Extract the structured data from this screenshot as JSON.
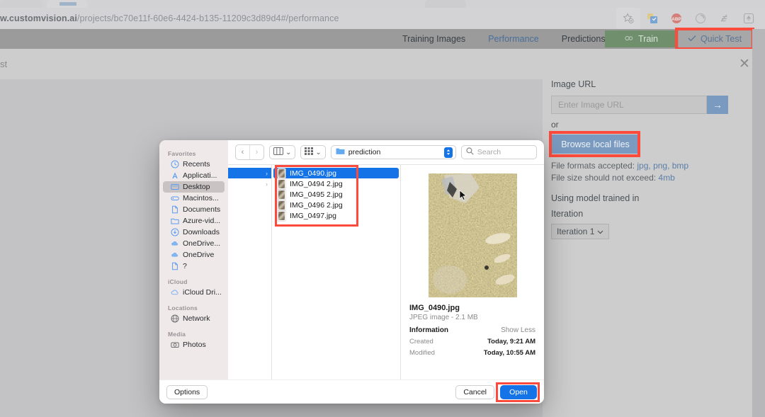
{
  "browser": {
    "url_prefix": "w.customvision.ai",
    "url_path": "/projects/bc70e11f-60e6-4424-b135-11209c3d89d4#/performance",
    "toolbar_icons": [
      "star-add-icon",
      "extension-icon",
      "adblock-plus-icon",
      "circle-icon",
      "reader-icon",
      "sync-icon"
    ]
  },
  "app": {
    "nav_tabs": [
      {
        "label": "Training Images",
        "selected": false
      },
      {
        "label": "Performance",
        "selected": true
      },
      {
        "label": "Predictions",
        "selected": false
      }
    ],
    "train_button": "Train",
    "quick_test_button": "Quick Test"
  },
  "modal": {
    "title": "st",
    "close": "✕",
    "image_url_label": "Image URL",
    "url_placeholder": "Enter Image URL",
    "url_go": "→",
    "or_label": "or",
    "browse_button": "Browse local files",
    "formats_prefix": "File formats accepted: ",
    "formats_value": "jpg, png, bmp",
    "size_prefix": "File size should not exceed: ",
    "size_value": "4mb",
    "using_model_label": "Using model trained in",
    "iteration_label": "Iteration",
    "iteration_value": "Iteration 1",
    "iteration_caret": "⌄"
  },
  "file_dialog": {
    "toolbar": {
      "back": "‹",
      "forward": "›",
      "view_caret": "⌄",
      "group_caret": "⌄",
      "path": "prediction",
      "search_placeholder": "Search"
    },
    "sidebar": [
      {
        "type": "group",
        "label": "Favorites"
      },
      {
        "type": "item",
        "label": "Recents",
        "icon": "clock-icon",
        "selected": false
      },
      {
        "type": "item",
        "label": "Applicati...",
        "icon": "applications-icon",
        "selected": false
      },
      {
        "type": "item",
        "label": "Desktop",
        "icon": "desktop-icon",
        "selected": true
      },
      {
        "type": "item",
        "label": "Macintos...",
        "icon": "harddisk-icon",
        "selected": false
      },
      {
        "type": "item",
        "label": "Documents",
        "icon": "document-icon",
        "selected": false
      },
      {
        "type": "item",
        "label": "Azure-vid...",
        "icon": "folder-icon",
        "selected": false
      },
      {
        "type": "item",
        "label": "Downloads",
        "icon": "download-icon",
        "selected": false
      },
      {
        "type": "item",
        "label": "OneDrive...",
        "icon": "cloud-icon",
        "selected": false
      },
      {
        "type": "item",
        "label": "OneDrive",
        "icon": "cloud-icon",
        "selected": false
      },
      {
        "type": "item",
        "label": "?",
        "icon": "document-icon",
        "selected": false
      },
      {
        "type": "group",
        "label": "iCloud"
      },
      {
        "type": "item",
        "label": "iCloud Dri...",
        "icon": "icloud-icon",
        "selected": false
      },
      {
        "type": "group",
        "label": "Locations"
      },
      {
        "type": "item",
        "label": "Network",
        "icon": "globe-icon",
        "selected": false
      },
      {
        "type": "group",
        "label": "Media"
      },
      {
        "type": "item",
        "label": "Photos",
        "icon": "camera-icon",
        "selected": false
      }
    ],
    "column_a": [
      {
        "chevron": "›",
        "selected": true
      },
      {
        "chevron": "›",
        "selected": false
      }
    ],
    "files": [
      {
        "name": "IMG_0490.jpg",
        "selected": true
      },
      {
        "name": "IMG_0494 2.jpg",
        "selected": false
      },
      {
        "name": "IMG_0495 2.jpg",
        "selected": false
      },
      {
        "name": "IMG_0496 2.jpg",
        "selected": false
      },
      {
        "name": "IMG_0497.jpg",
        "selected": false
      }
    ],
    "info": {
      "name": "IMG_0490.jpg",
      "subtitle": "JPEG image - 2.1 MB",
      "section_title": "Information",
      "toggle": "Show Less",
      "rows": [
        {
          "key": "Created",
          "value": "Today, 9:21 AM"
        },
        {
          "key": "Modified",
          "value": "Today, 10:55 AM"
        }
      ]
    },
    "footer": {
      "options": "Options",
      "cancel": "Cancel",
      "open": "Open"
    }
  },
  "colors": {
    "accent_blue": "#1473e6",
    "highlight_red": "#fc4a3c",
    "azure_blue": "#7a9ac0",
    "train_green": "#6f8f6d"
  }
}
